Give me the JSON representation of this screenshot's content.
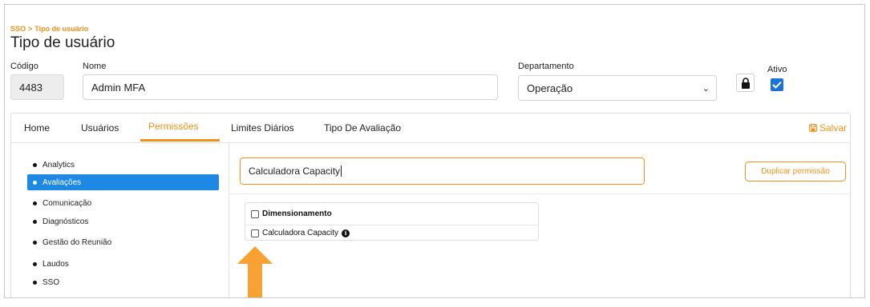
{
  "breadcrumb": {
    "root": "SSO",
    "separator": ">",
    "current": "Tipo de usuário"
  },
  "page_title": "Tipo de usuário",
  "form": {
    "codigo_label": "Código",
    "codigo_value": "4483",
    "nome_label": "Nome",
    "nome_value": "Admin MFA",
    "departamento_label": "Departamento",
    "departamento_value": "Operação",
    "ativo_label": "Ativo",
    "ativo_checked": true
  },
  "tabs": [
    {
      "label": "Home",
      "active": false
    },
    {
      "label": "Usuários",
      "active": false
    },
    {
      "label": "Permissões",
      "active": true
    },
    {
      "label": "Limites Diários",
      "active": false
    },
    {
      "label": "Tipo De Avaliação",
      "active": false
    }
  ],
  "save_label": "Salvar",
  "sidebar": {
    "items": [
      {
        "label": "Analytics",
        "active": false
      },
      {
        "label": "Avaliações",
        "active": true
      },
      {
        "label": "Comunicação",
        "active": false
      },
      {
        "label": "Diagnósticos",
        "active": false
      },
      {
        "label": "Gestão do Reunião",
        "active": false
      },
      {
        "label": "Laudos",
        "active": false
      },
      {
        "label": "SSO",
        "active": false
      }
    ]
  },
  "search": {
    "value": "Calculadora Capacity"
  },
  "duplicate_button_label": "Duplicar permissão",
  "permissions": {
    "group_label": "Dimensionamento",
    "group_checked": false,
    "items": [
      {
        "label": "Calculadora Capacity",
        "checked": false
      }
    ]
  },
  "colors": {
    "accent": "#f0921a",
    "active_blue": "#1e88e5",
    "checkbox_blue": "#1a73d9",
    "arrow": "#f7a233"
  }
}
